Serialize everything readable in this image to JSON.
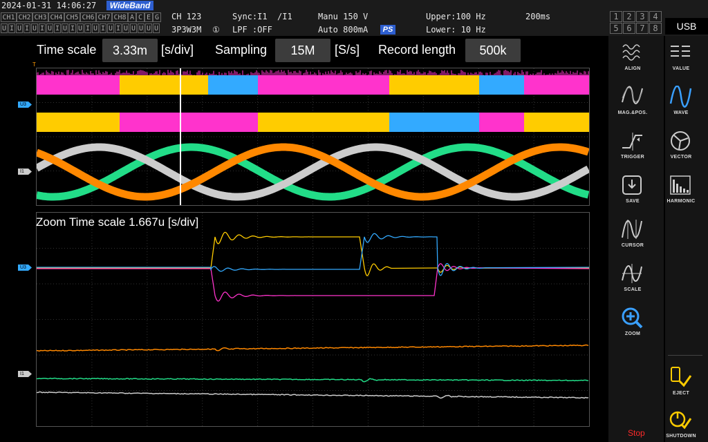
{
  "status": {
    "datetime": "2024-01-31 14:06:27",
    "mode_badge": "WideBand",
    "ch_cells": [
      "CH1",
      "CH2",
      "CH3",
      "CH4",
      "CH5",
      "CH6",
      "CH7",
      "CH8",
      "A",
      "C",
      "E",
      "G"
    ],
    "u_cells": [
      "U",
      "I",
      "U",
      "I",
      "U",
      "I",
      "U",
      "I",
      "U",
      "I",
      "U",
      "I",
      "U",
      "I",
      "U",
      "I",
      "U",
      "U",
      "U",
      "U",
      "U"
    ],
    "ch_label": "CH 123",
    "wiring": "3P3W3M",
    "circle_num": "①",
    "sync": "Sync:I1  /I1",
    "lpf": "LPF :OFF",
    "range_v": "Manu 150 V",
    "range_i": "Auto 800mA",
    "ps_badge": "PS",
    "upper": "Upper:100 Hz",
    "lower": "Lower: 10 Hz",
    "interval": "200ms",
    "group_top": [
      "1",
      "2",
      "3",
      "4"
    ],
    "group_bottom": [
      "5",
      "6",
      "7",
      "8"
    ],
    "usb": "USB"
  },
  "settings": {
    "time_scale_label": "Time scale",
    "time_scale_value": "3.33m",
    "time_scale_unit": "[s/div]",
    "sampling_label": "Sampling",
    "sampling_value": "15M",
    "sampling_unit": "[S/s]",
    "record_label": "Record length",
    "record_value": "500k"
  },
  "upper_panel": {
    "trigger_marker": "T",
    "marker_u": "U3",
    "marker_i": "I1"
  },
  "zoom_panel": {
    "title": "Zoom Time scale 1.667u [s/div]",
    "marker_u": "U3",
    "marker_i": "I1"
  },
  "side_menu": [
    {
      "key": "align",
      "label": "ALIGN",
      "icon": "align-icon"
    },
    {
      "key": "value",
      "label": "VALUE",
      "icon": "value-icon"
    },
    {
      "key": "mag",
      "label": "MAG.&POS.",
      "icon": "mag-pos-icon"
    },
    {
      "key": "wave",
      "label": "WAVE",
      "icon": "wave-icon",
      "active": true
    },
    {
      "key": "trigger",
      "label": "TRIGGER",
      "icon": "trigger-icon"
    },
    {
      "key": "vector",
      "label": "VECTOR",
      "icon": "vector-icon"
    },
    {
      "key": "save",
      "label": "SAVE",
      "icon": "save-icon"
    },
    {
      "key": "harmonic",
      "label": "HARMONIC",
      "icon": "harmonic-icon"
    },
    {
      "key": "cursor",
      "label": "CURSOR",
      "icon": "cursor-icon"
    },
    {
      "key": "scale",
      "label": "SCALE",
      "icon": "scale-icon"
    },
    {
      "key": "zoom",
      "label": "ZOOM",
      "icon": "zoom-icon"
    },
    {
      "key": "eject",
      "label": "EJECT",
      "icon": "eject-icon"
    },
    {
      "key": "shutdown",
      "label": "SHUTDOWN",
      "icon": "shutdown-icon"
    }
  ],
  "run_state": "Stop",
  "colors": {
    "u1": "#ffcc00",
    "u2": "#ff33cc",
    "u3": "#33aaff",
    "i1": "#ff8800",
    "i2": "#22dd88",
    "i3": "#cccccc",
    "accent": "#2e5fd0",
    "stop": "#ff2a2a"
  }
}
